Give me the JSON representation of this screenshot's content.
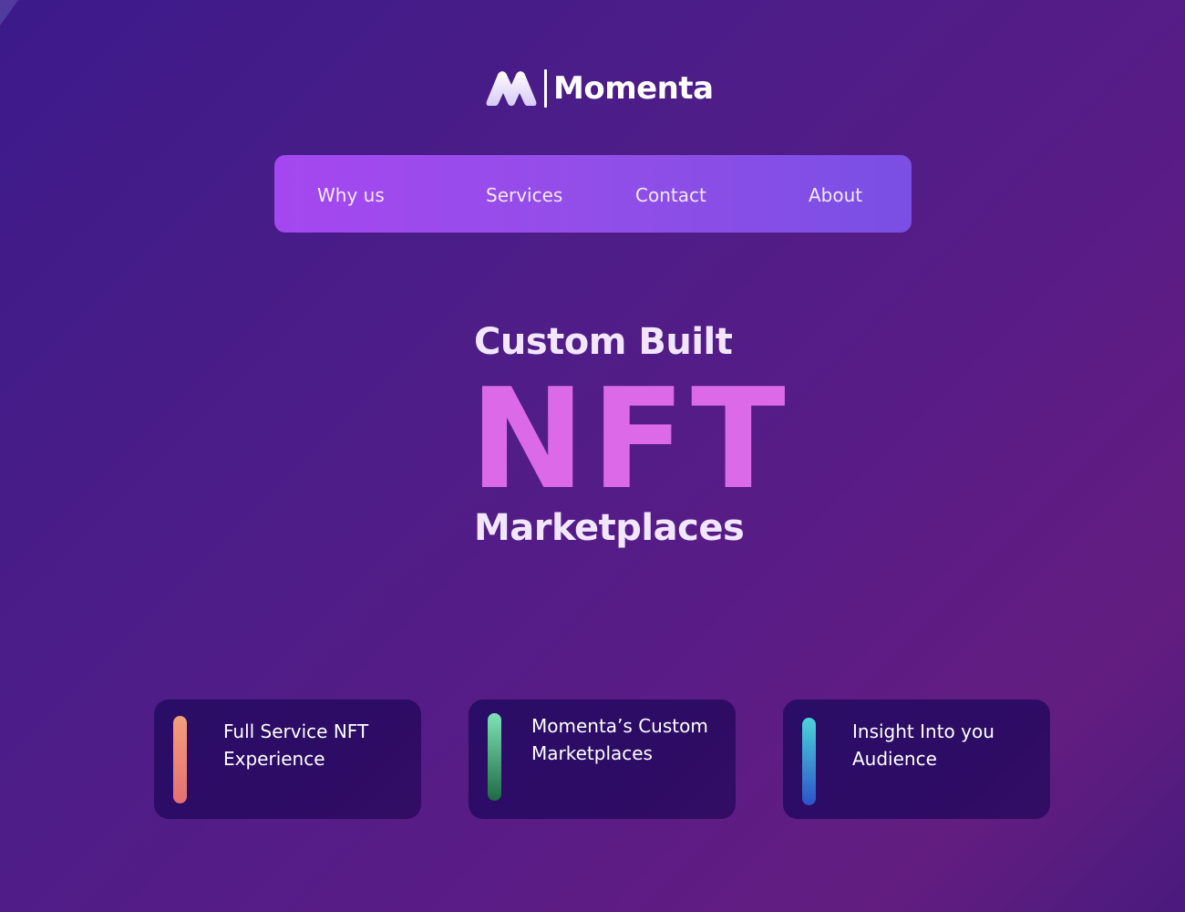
{
  "logo": {
    "icon": "m-logo-icon",
    "text": "Momenta"
  },
  "nav": {
    "items": [
      {
        "label": "Why us"
      },
      {
        "label": "Services"
      },
      {
        "label": "Contact"
      },
      {
        "label": "About"
      }
    ]
  },
  "hero": {
    "line1": "Custom Built",
    "line2": "NFT",
    "line3": "Marketplaces"
  },
  "cards": [
    {
      "text": "Full Service NFT Experience",
      "accent": [
        "#f2a07a",
        "#e46f73"
      ]
    },
    {
      "text": "Momenta’s Custom Marketplaces",
      "accent": [
        "#7fe3b5",
        "#1e6b45"
      ]
    },
    {
      "text": "Insight Into you Audience",
      "accent": [
        "#4cd3d9",
        "#2a53c9"
      ]
    }
  ],
  "colors": {
    "nav_gradient_start": "#a547f0",
    "nav_gradient_end": "#7a4fe4",
    "nft_pink": "#dc6ae8",
    "headline_text": "#f2e6ff",
    "card_bg": "#2a0d66"
  }
}
